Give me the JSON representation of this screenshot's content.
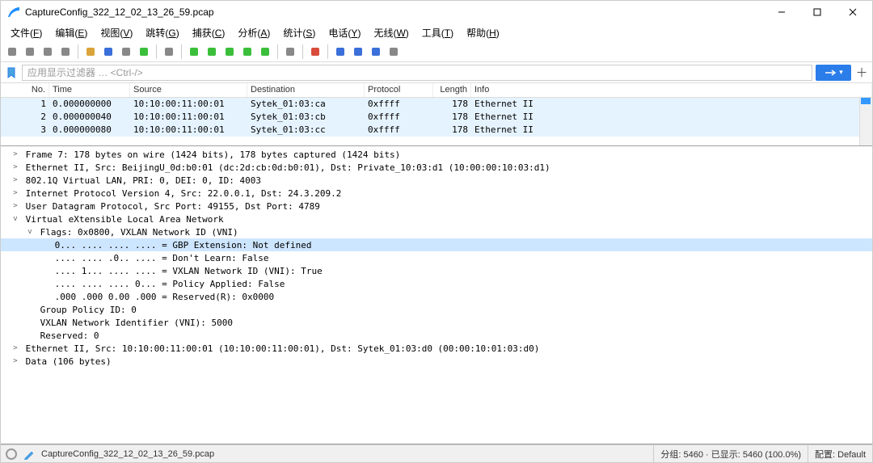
{
  "title": "CaptureConfig_322_12_02_13_26_59.pcap",
  "menu": [
    "文件(F)",
    "编辑(E)",
    "视图(V)",
    "跳转(G)",
    "捕获(C)",
    "分析(A)",
    "统计(S)",
    "电话(Y)",
    "无线(W)",
    "工具(T)",
    "帮助(H)"
  ],
  "filter_placeholder": "应用显示过滤器 … <Ctrl-/>",
  "columns": {
    "no": "No.",
    "time": "Time",
    "source": "Source",
    "destination": "Destination",
    "protocol": "Protocol",
    "length": "Length",
    "info": "Info"
  },
  "packets": [
    {
      "no": "1",
      "time": "0.000000000",
      "src": "10:10:00:11:00:01",
      "dst": "Sytek_01:03:ca",
      "proto": "0xffff",
      "len": "178",
      "info": "Ethernet II"
    },
    {
      "no": "2",
      "time": "0.000000040",
      "src": "10:10:00:11:00:01",
      "dst": "Sytek_01:03:cb",
      "proto": "0xffff",
      "len": "178",
      "info": "Ethernet II"
    },
    {
      "no": "3",
      "time": "0.000000080",
      "src": "10:10:00:11:00:01",
      "dst": "Sytek_01:03:cc",
      "proto": "0xffff",
      "len": "178",
      "info": "Ethernet II"
    }
  ],
  "details": [
    {
      "indent": 0,
      "toggle": ">",
      "text": "Frame 7: 178 bytes on wire (1424 bits), 178 bytes captured (1424 bits)"
    },
    {
      "indent": 0,
      "toggle": ">",
      "text": "Ethernet II, Src: BeijingU_0d:b0:01 (dc:2d:cb:0d:b0:01), Dst: Private_10:03:d1 (10:00:00:10:03:d1)"
    },
    {
      "indent": 0,
      "toggle": ">",
      "text": "802.1Q Virtual LAN, PRI: 0, DEI: 0, ID: 4003"
    },
    {
      "indent": 0,
      "toggle": ">",
      "text": "Internet Protocol Version 4, Src: 22.0.0.1, Dst: 24.3.209.2"
    },
    {
      "indent": 0,
      "toggle": ">",
      "text": "User Datagram Protocol, Src Port: 49155, Dst Port: 4789"
    },
    {
      "indent": 0,
      "toggle": "v",
      "text": "Virtual eXtensible Local Area Network"
    },
    {
      "indent": 1,
      "toggle": "v",
      "text": "Flags: 0x0800, VXLAN Network ID (VNI)"
    },
    {
      "indent": 2,
      "toggle": "",
      "text": "0... .... .... .... = GBP Extension: Not defined",
      "selected": true
    },
    {
      "indent": 2,
      "toggle": "",
      "text": ".... .... .0.. .... = Don't Learn: False"
    },
    {
      "indent": 2,
      "toggle": "",
      "text": ".... 1... .... .... = VXLAN Network ID (VNI): True"
    },
    {
      "indent": 2,
      "toggle": "",
      "text": ".... .... .... 0... = Policy Applied: False"
    },
    {
      "indent": 2,
      "toggle": "",
      "text": ".000 .000 0.00 .000 = Reserved(R): 0x0000"
    },
    {
      "indent": 1,
      "toggle": "",
      "text": "Group Policy ID: 0"
    },
    {
      "indent": 1,
      "toggle": "",
      "text": "VXLAN Network Identifier (VNI): 5000"
    },
    {
      "indent": 1,
      "toggle": "",
      "text": "Reserved: 0"
    },
    {
      "indent": 0,
      "toggle": ">",
      "text": "Ethernet II, Src: 10:10:00:11:00:01 (10:10:00:11:00:01), Dst: Sytek_01:03:d0 (00:00:10:01:03:d0)"
    },
    {
      "indent": 0,
      "toggle": ">",
      "text": "Data (106 bytes)"
    }
  ],
  "status": {
    "file": "CaptureConfig_322_12_02_13_26_59.pcap",
    "packets": "分组: 5460 · 已显示: 5460 (100.0%)",
    "profile": "配置: Default"
  },
  "icons": {
    "toolbar": [
      {
        "name": "toolbar-start-icon",
        "fill": "#888"
      },
      {
        "name": "toolbar-stop-icon",
        "fill": "#888"
      },
      {
        "name": "toolbar-restart-icon",
        "fill": "#888"
      },
      {
        "name": "toolbar-options-icon",
        "fill": "#888"
      },
      {
        "sep": true
      },
      {
        "name": "toolbar-open-icon",
        "fill": "#d9a43b"
      },
      {
        "name": "toolbar-save-icon",
        "fill": "#3b6fd9"
      },
      {
        "name": "toolbar-close-icon",
        "fill": "#888"
      },
      {
        "name": "toolbar-reload-icon",
        "fill": "#3bbf3b"
      },
      {
        "sep": true
      },
      {
        "name": "toolbar-find-icon",
        "fill": "#888"
      },
      {
        "sep": true
      },
      {
        "name": "toolbar-back-icon",
        "fill": "#3bbf3b"
      },
      {
        "name": "toolbar-fwd-icon",
        "fill": "#3bbf3b"
      },
      {
        "name": "toolbar-jump-icon",
        "fill": "#3bbf3b"
      },
      {
        "name": "toolbar-first-icon",
        "fill": "#3bbf3b"
      },
      {
        "name": "toolbar-last-icon",
        "fill": "#3bbf3b"
      },
      {
        "sep": true
      },
      {
        "name": "toolbar-autoscroll-icon",
        "fill": "#888"
      },
      {
        "sep": true
      },
      {
        "name": "toolbar-colorize-icon",
        "fill": "#d94c3b"
      },
      {
        "sep": true
      },
      {
        "name": "toolbar-zoomin-icon",
        "fill": "#3b6fd9"
      },
      {
        "name": "toolbar-zoomout-icon",
        "fill": "#3b6fd9"
      },
      {
        "name": "toolbar-zoom100-icon",
        "fill": "#3b6fd9"
      },
      {
        "name": "toolbar-resize-icon",
        "fill": "#888"
      }
    ]
  }
}
